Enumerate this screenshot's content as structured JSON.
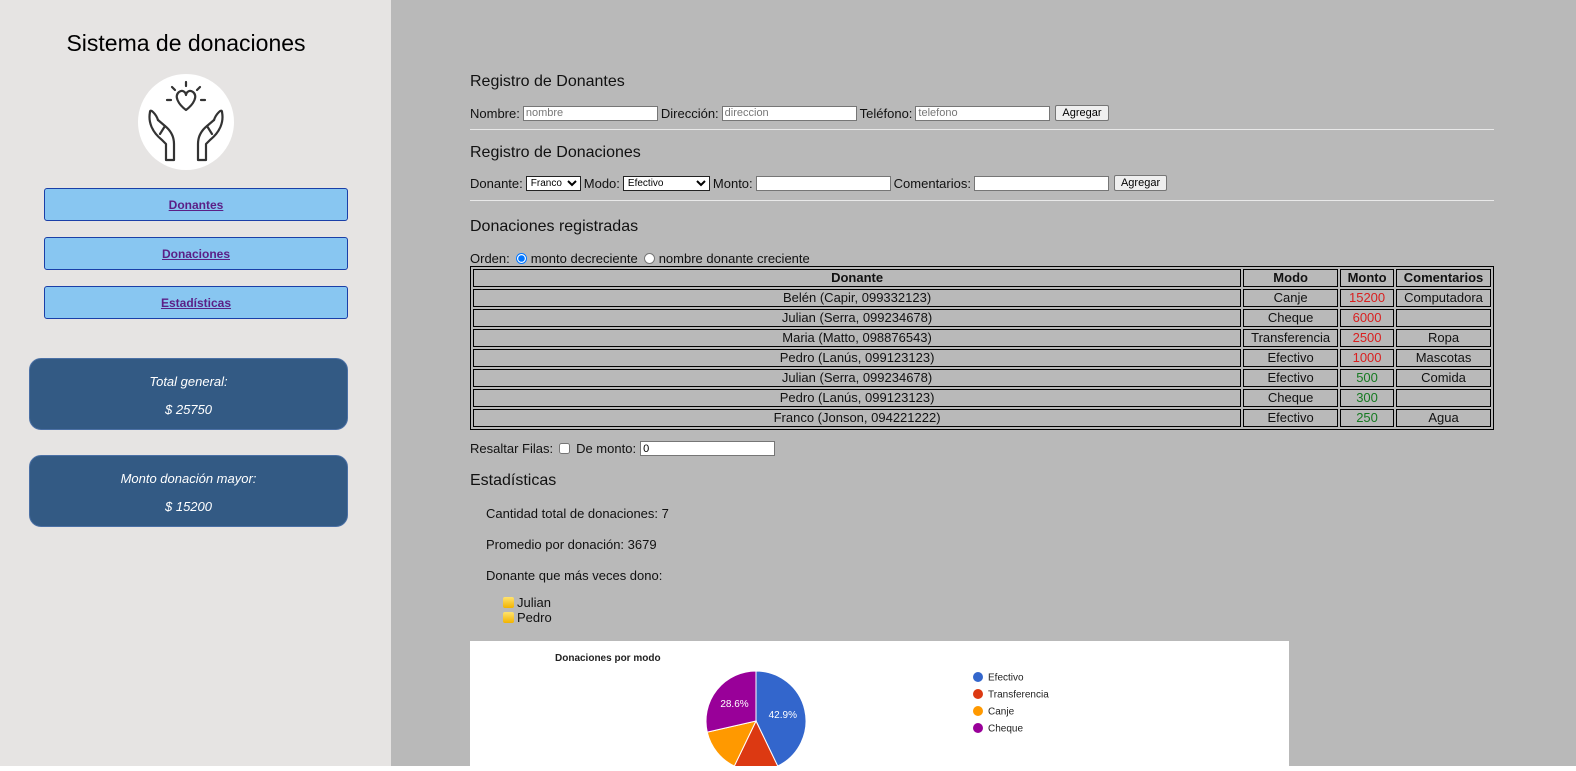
{
  "sidebar": {
    "title": "Sistema de donaciones",
    "nav": [
      {
        "label": "Donantes"
      },
      {
        "label": "Donaciones"
      },
      {
        "label": "Estadísticas"
      }
    ],
    "total_label": "Total general:",
    "total_value": "$ 25750",
    "max_label": "Monto donación mayor:",
    "max_value": "$ 15200"
  },
  "donantes_form": {
    "heading": "Registro de Donantes",
    "nombre_label": "Nombre:",
    "nombre_placeholder": "nombre",
    "direccion_label": "Dirección:",
    "direccion_placeholder": "direccion",
    "telefono_label": "Teléfono:",
    "telefono_placeholder": "telefono",
    "submit": "Agregar"
  },
  "donaciones_form": {
    "heading": "Registro de Donaciones",
    "donante_label": "Donante:",
    "donante_selected": "Franco",
    "modo_label": "Modo:",
    "modo_selected": "Efectivo",
    "monto_label": "Monto:",
    "comentarios_label": "Comentarios:",
    "submit": "Agregar"
  },
  "registradas": {
    "heading": "Donaciones registradas",
    "orden_label": "Orden:",
    "orden_option_1": "monto decreciente",
    "orden_option_2": "nombre donante creciente",
    "orden_selected": "monto decreciente",
    "columns": [
      "Donante",
      "Modo",
      "Monto",
      "Comentarios"
    ],
    "rows": [
      {
        "donante": "Belén (Capir, 099332123)",
        "modo": "Canje",
        "monto": "15200",
        "comentarios": "Computadora",
        "level": "high"
      },
      {
        "donante": "Julian (Serra, 099234678)",
        "modo": "Cheque",
        "monto": "6000",
        "comentarios": "",
        "level": "high"
      },
      {
        "donante": "Maria (Matto, 098876543)",
        "modo": "Transferencia",
        "monto": "2500",
        "comentarios": "Ropa",
        "level": "high"
      },
      {
        "donante": "Pedro (Lanús, 099123123)",
        "modo": "Efectivo",
        "monto": "1000",
        "comentarios": "Mascotas",
        "level": "high"
      },
      {
        "donante": "Julian (Serra, 099234678)",
        "modo": "Efectivo",
        "monto": "500",
        "comentarios": "Comida",
        "level": "low"
      },
      {
        "donante": "Pedro (Lanús, 099123123)",
        "modo": "Cheque",
        "monto": "300",
        "comentarios": "",
        "level": "low"
      },
      {
        "donante": "Franco (Jonson, 094221222)",
        "modo": "Efectivo",
        "monto": "250",
        "comentarios": "Agua",
        "level": "low"
      }
    ],
    "resaltar_label": "Resaltar Filas:",
    "resaltar_checked": false,
    "de_monto_label": "De monto:",
    "de_monto_value": "0"
  },
  "estadisticas": {
    "heading": "Estadísticas",
    "cantidad": "Cantidad total de donaciones: 7",
    "promedio": "Promedio por donación: 3679",
    "mas_veces": "Donante que más veces dono:",
    "top_donantes": [
      "Julian",
      "Pedro"
    ]
  },
  "colors": {
    "sidebar_bg": "#e6e4e3",
    "main_bg": "#b9b9b9",
    "nav_button": "#88c6f1",
    "stat_card": "#335a84",
    "monto_high": "#d91f1f",
    "monto_low": "#177a22"
  },
  "chart_data": {
    "type": "pie",
    "title": "Donaciones por modo",
    "legend_position": "right",
    "slices": [
      {
        "name": "Efectivo",
        "value": 3,
        "label": "42.9%",
        "color": "#3366cc"
      },
      {
        "name": "Transferencia",
        "value": 1,
        "label": "",
        "color": "#dc3912"
      },
      {
        "name": "Canje",
        "value": 1,
        "label": "",
        "color": "#ff9900"
      },
      {
        "name": "Cheque",
        "value": 2,
        "label": "28.6%",
        "color": "#990099"
      }
    ]
  }
}
